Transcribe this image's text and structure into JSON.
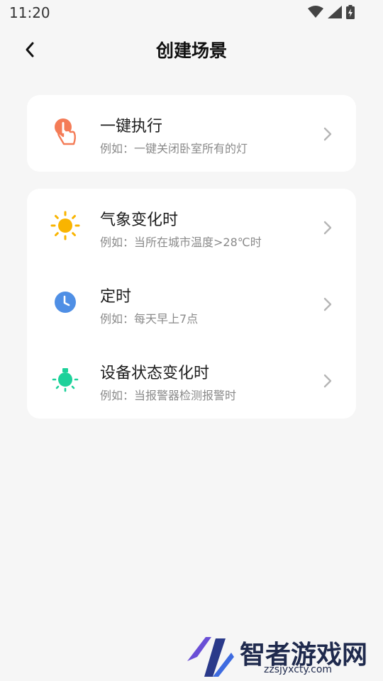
{
  "status_bar": {
    "time": "11:20",
    "icons": [
      "wifi-icon",
      "cell-signal-icon",
      "battery-charging-icon"
    ]
  },
  "header": {
    "title": "创建场景",
    "back_icon": "back-arrow-icon"
  },
  "cards": [
    {
      "rows": [
        {
          "title": "一键执行",
          "subtitle": "例如：一键关闭卧室所有的灯",
          "icon": "tap-hand-icon",
          "icon_color": "#f47c57"
        }
      ]
    },
    {
      "rows": [
        {
          "title": "气象变化时",
          "subtitle": "例如：当所在城市温度>28℃时",
          "icon": "sun-icon",
          "icon_color": "#f9b400"
        },
        {
          "title": "定时",
          "subtitle": "例如：每天早上7点",
          "icon": "clock-icon",
          "icon_color": "#4f8fe5"
        },
        {
          "title": "设备状态变化时",
          "subtitle": "例如：当报警器检测报警时",
          "icon": "device-sensor-icon",
          "icon_color": "#1dd19a"
        }
      ]
    }
  ],
  "watermark": {
    "brand": "智者游戏网",
    "domain": "zzsjyxcty.com"
  }
}
